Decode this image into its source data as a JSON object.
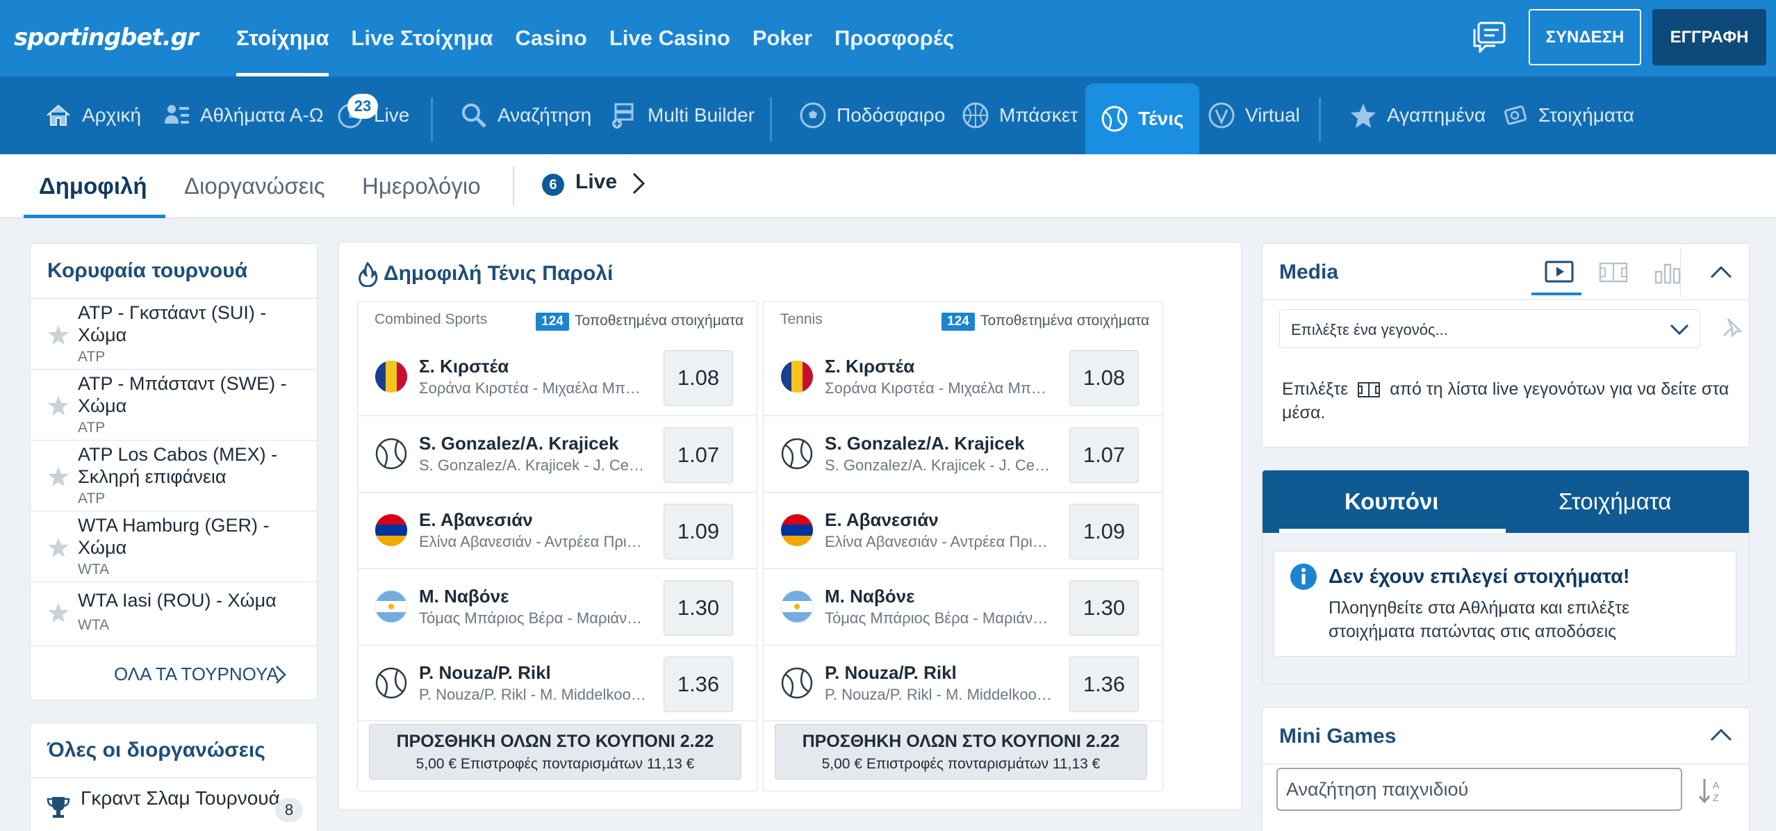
{
  "brand": {
    "logo_text": "sportingbet.gr"
  },
  "top_nav": {
    "items": [
      {
        "label": "Στοίχημα"
      },
      {
        "label": "Live Στοίχημα"
      },
      {
        "label": "Casino"
      },
      {
        "label": "Live Casino"
      },
      {
        "label": "Poker"
      },
      {
        "label": "Προσφορές"
      }
    ],
    "active": "Στοίχημα",
    "login_label": "ΣΥΝΔΕΣΗ",
    "register_label": "ΕΓΓΡΑΦΗ"
  },
  "sport_nav": {
    "items": [
      {
        "label": "Αρχική",
        "icon": "home-icon"
      },
      {
        "label": "Αθλήματα Α-Ω",
        "icon": "sports-az-icon"
      },
      {
        "label": "Live",
        "icon": "live-clock-icon",
        "badge": "23"
      },
      {
        "label": "Αναζήτηση",
        "icon": "search-icon"
      },
      {
        "label": "Multi Builder",
        "icon": "multi-builder-icon"
      },
      {
        "label": "Ποδόσφαιρο",
        "icon": "football-icon"
      },
      {
        "label": "Μπάσκετ",
        "icon": "basketball-icon"
      },
      {
        "label": "Τένις",
        "icon": "tennis-icon"
      },
      {
        "label": "Virtual",
        "icon": "virtual-icon"
      },
      {
        "label": "Αγαπημένα",
        "icon": "star-icon"
      },
      {
        "label": "Στοιχήματα",
        "icon": "bets-icon"
      }
    ],
    "active": "Τένις"
  },
  "sub_tabs": {
    "items": [
      {
        "label": "Δημοφιλή"
      },
      {
        "label": "Διοργανώσεις"
      },
      {
        "label": "Ημερολόγιο"
      }
    ],
    "active": "Δημοφιλή",
    "live_count": "6",
    "live_label": "Live"
  },
  "top_tournaments": {
    "title": "Κορυφαία τουρνουά",
    "items": [
      {
        "name": "ATP - Γκστάαντ (SUI) - Χώμα",
        "category": "ATP"
      },
      {
        "name": "ATP - Μπάσταντ (SWE) - Χώμα",
        "category": "ATP"
      },
      {
        "name": "ATP Los Cabos (MEX) - Σκληρή επιφάνεια",
        "category": "ATP"
      },
      {
        "name": "WTA Hamburg (GER) - Χώμα",
        "category": "WTA"
      },
      {
        "name": "WTA Iasi (ROU) - Χώμα",
        "category": "WTA"
      }
    ],
    "all_label": "ΟΛΑ ΤΑ ΤΟΥΡΝΟΥΑ"
  },
  "all_competitions": {
    "title": "Όλες οι διοργανώσεις",
    "items": [
      {
        "name": "Γκραντ Σλαμ Τουρνουά",
        "count": "8"
      }
    ]
  },
  "popular_parlay": {
    "title": "Δημοφιλή Τένις Παρολί",
    "combos": [
      {
        "header": "Combined Sports",
        "placed_count": "124",
        "placed_label": "Τοποθετημένα στοιχήματα",
        "matches": [
          {
            "name": "Σ. Κιρστέα",
            "sub": "Σοράνα Κιρστέα - Μιχαέλα Μπουζαρνέσκου",
            "odd": "1.08",
            "icon": "flag-romania-icon"
          },
          {
            "name": "S. Gonzalez/A. Krajicek",
            "sub": "S. Gonzalez/A. Krajicek - J. Cerretani/N. Monroe",
            "odd": "1.07",
            "icon": "tennis-ball-icon"
          },
          {
            "name": "Ε. Αβανεσιάν",
            "sub": "Ελίνα Αβανεσιάν - Αντρέεα Πρισακαρίου",
            "odd": "1.09",
            "icon": "flag-armenia-icon"
          },
          {
            "name": "Μ. Ναβόνε",
            "sub": "Τόμας Μπάριος Βέρα - Μαριάνο Ναβόνε",
            "odd": "1.30",
            "icon": "flag-argentina-icon"
          },
          {
            "name": "P. Nouza/P. Rikl",
            "sub": "P. Nouza/P. Rikl - M. Middelkoop/R. Haase",
            "odd": "1.36",
            "icon": "tennis-ball-icon"
          }
        ],
        "add_all_label": "ΠΡΟΣΘΗΚΗ ΟΛΩΝ ΣΤΟ ΚΟΥΠΟΝΙ 2.22",
        "returns_label": "5,00 € Επιστροφές πονταρισμάτων 11,13 €"
      },
      {
        "header": "Tennis",
        "placed_count": "124",
        "placed_label": "Τοποθετημένα στοιχήματα",
        "matches": [
          {
            "name": "Σ. Κιρστέα",
            "sub": "Σοράνα Κιρστέα - Μιχαέλα Μπουζαρνέσκου",
            "odd": "1.08",
            "icon": "flag-romania-icon"
          },
          {
            "name": "S. Gonzalez/A. Krajicek",
            "sub": "S. Gonzalez/A. Krajicek - J. Cerretani/N. Monroe",
            "odd": "1.07",
            "icon": "tennis-ball-icon"
          },
          {
            "name": "Ε. Αβανεσιάν",
            "sub": "Ελίνα Αβανεσιάν - Αντρέεα Πρισακαρίου",
            "odd": "1.09",
            "icon": "flag-armenia-icon"
          },
          {
            "name": "Μ. Ναβόνε",
            "sub": "Τόμας Μπάριος Βέρα - Μαριάνο Ναβόνε",
            "odd": "1.30",
            "icon": "flag-argentina-icon"
          },
          {
            "name": "P. Nouza/P. Rikl",
            "sub": "P. Nouza/P. Rikl - M. Middelkoop/R. Haase",
            "odd": "1.36",
            "icon": "tennis-ball-icon"
          }
        ],
        "add_all_label": "ΠΡΟΣΘΗΚΗ ΟΛΩΝ ΣΤΟ ΚΟΥΠΟΝΙ 2.22",
        "returns_label": "5,00 € Επιστροφές πονταρισμάτων 11,13 €"
      }
    ]
  },
  "media": {
    "title": "Media",
    "select_placeholder": "Επιλέξτε ένα γεγονός...",
    "info_before": "Επιλέξτε",
    "info_after": "από τη λίστα live γεγονότων για να δείτε στα μέσα."
  },
  "betslip": {
    "tabs": [
      {
        "label": "Κουπόνι"
      },
      {
        "label": "Στοιχήματα"
      }
    ],
    "active": "Κουπόνι",
    "empty_title": "Δεν έχουν επιλεγεί στοιχήματα!",
    "empty_text": "Πλοηγηθείτε στα Αθλήματα και επιλέξτε στοιχήματα πατώντας στις αποδόσεις"
  },
  "mini_games": {
    "title": "Mini Games",
    "search_placeholder": "Αναζήτηση παιχνιδιού"
  },
  "colors": {
    "header_blue": "#1a84d1",
    "nav_blue": "#116db3",
    "active_tab_blue": "#1a8ee0",
    "betslip_head": "#0f5a92",
    "register_button": "#0d4a7a"
  }
}
